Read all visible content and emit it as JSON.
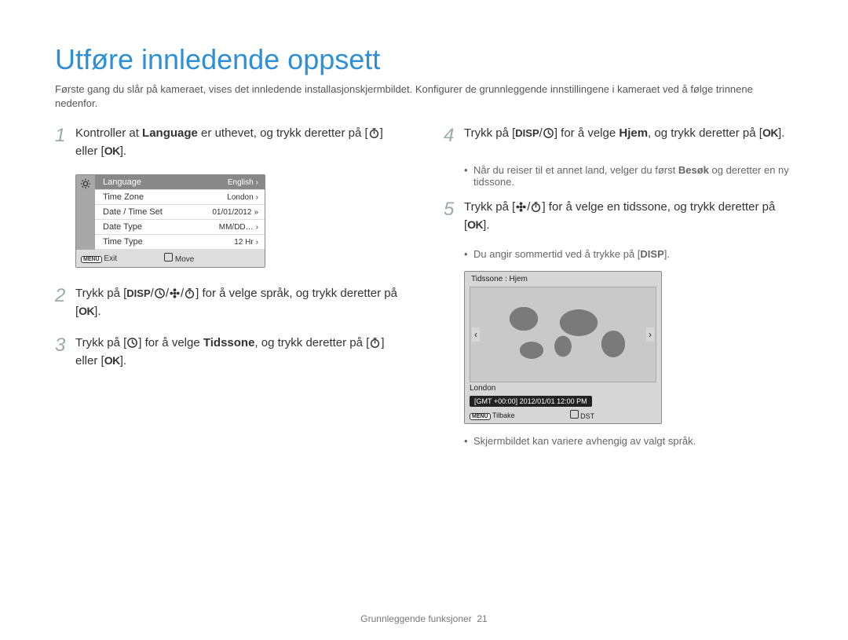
{
  "title": "Utføre innledende oppsett",
  "intro": "Første gang du slår på kameraet, vises det innledende installasjonskjermbildet. Konfigurer de grunnleggende innstillingene i kameraet ved å følge trinnene nedenfor.",
  "steps": {
    "s1": {
      "num": "1",
      "pre": "Kontroller at ",
      "bold": "Language",
      "post": " er uthevet, og trykk deretter på [",
      "end": "] eller ["
    },
    "s2": {
      "num": "2",
      "pre": "Trykk på [",
      "mid": "] for å velge språk, og trykk deretter på ["
    },
    "s3": {
      "num": "3",
      "pre": "Trykk på [",
      "mid": "] for å velge ",
      "bold": "Tidssone",
      "post": ", og trykk deretter på [",
      "end": "] eller ["
    },
    "s4": {
      "num": "4",
      "pre": "Trykk på [",
      "mid": "] for å velge ",
      "bold": "Hjem",
      "post": ", og trykk deretter på ["
    },
    "s5": {
      "num": "5",
      "pre": "Trykk på [",
      "mid": "] for å velge en tidssone, og trykk deretter på ["
    }
  },
  "bullets": {
    "b1a": "Når du reiser til et annet land, velger du først ",
    "b1bold": "Besøk",
    "b1b": " og deretter en ny tidssone.",
    "b2a": "Du angir sommertid ved å trykke på [",
    "b3": "Skjermbildet kan variere avhengig av valgt språk."
  },
  "icons": {
    "disp": "DISP",
    "ok": "OK",
    "menu": "MENU"
  },
  "settingsScreen": {
    "rows": [
      {
        "label": "Language",
        "value": "English"
      },
      {
        "label": "Time Zone",
        "value": "London"
      },
      {
        "label": "Date / Time Set",
        "value": "01/01/2012"
      },
      {
        "label": "Date Type",
        "value": "MM/DD…"
      },
      {
        "label": "Time Type",
        "value": "12 Hr"
      }
    ],
    "exit": "Exit",
    "move": "Move"
  },
  "mapScreen": {
    "title": "Tidssone : Hjem",
    "city": "London",
    "gmt": "[GMT +00:00]  2012/01/01  12:00 PM",
    "back": "Tilbake",
    "dst": "DST"
  },
  "footer": {
    "section": "Grunnleggende funksjoner",
    "page": "21"
  }
}
